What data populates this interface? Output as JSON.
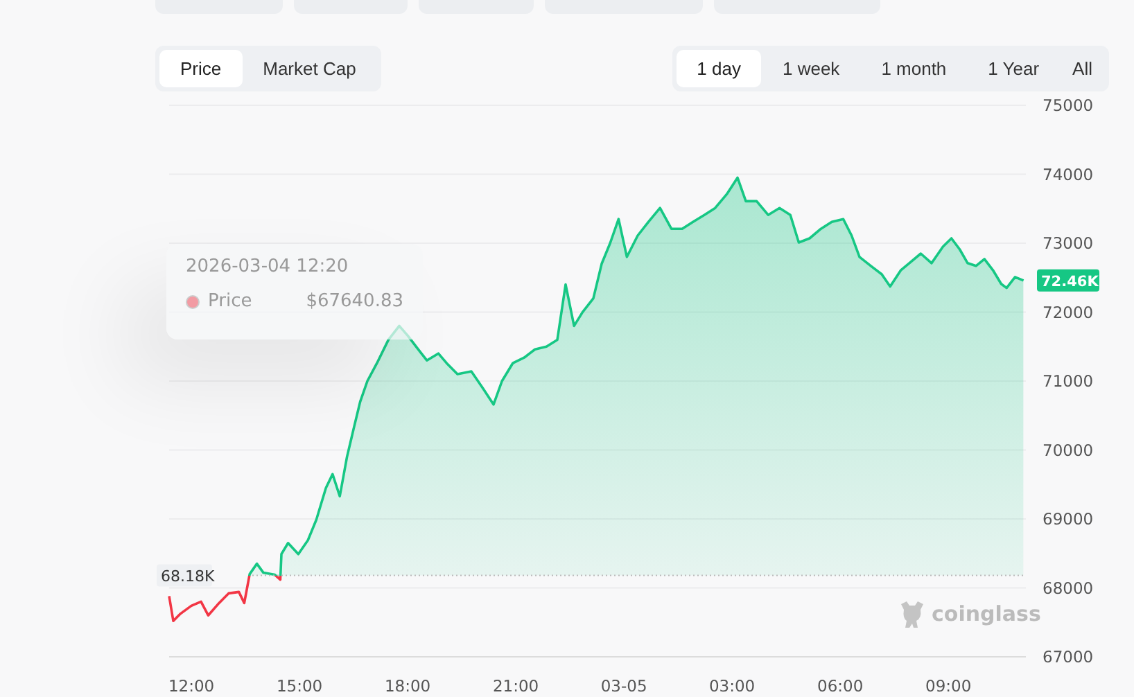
{
  "metric_tabs": [
    {
      "label": "Price",
      "selected": true
    },
    {
      "label": "Market Cap",
      "selected": false
    }
  ],
  "range_tabs": [
    {
      "label": "1 day",
      "selected": true
    },
    {
      "label": "1 week",
      "selected": false
    },
    {
      "label": "1 month",
      "selected": false
    },
    {
      "label": "1 Year",
      "selected": false
    },
    {
      "label": "All",
      "selected": false
    }
  ],
  "chart": {
    "below_baseline": {
      "color": "#f23645"
    },
    "last_price_label": "72.46K",
    "tooltip": {
      "time": "2026-03-04 12:20",
      "value": "$67640.83",
      "color": "#f29ba3"
    },
    "brand": {
      "name": "coinglass"
    },
    "chart_data": {
      "type": "area",
      "x": [
        "2026-03-04T11:23",
        "2026-03-04T11:30",
        "2026-03-04T11:41",
        "2026-03-04T12:00",
        "2026-03-04T12:16",
        "2026-03-04T12:28",
        "2026-03-04T12:46",
        "2026-03-04T13:02",
        "2026-03-04T13:19",
        "2026-03-04T13:28",
        "2026-03-04T13:37",
        "2026-03-04T13:49",
        "2026-03-04T14:00",
        "2026-03-04T14:19",
        "2026-03-04T14:28",
        "2026-03-04T14:30",
        "2026-03-04T14:41",
        "2026-03-04T14:58",
        "2026-03-04T15:14",
        "2026-03-04T15:28",
        "2026-03-04T15:44",
        "2026-03-04T15:55",
        "2026-03-04T16:07",
        "2026-03-04T16:19",
        "2026-03-04T16:30",
        "2026-03-04T16:41",
        "2026-03-04T16:53",
        "2026-03-04T17:09",
        "2026-03-04T17:28",
        "2026-03-04T17:46",
        "2026-03-04T18:00",
        "2026-03-04T18:14",
        "2026-03-04T18:32",
        "2026-03-04T18:51",
        "2026-03-04T19:05",
        "2026-03-04T19:23",
        "2026-03-04T19:46",
        "2026-03-04T20:05",
        "2026-03-04T20:23",
        "2026-03-04T20:37",
        "2026-03-04T20:55",
        "2026-03-04T21:14",
        "2026-03-04T21:32",
        "2026-03-04T21:51",
        "2026-03-04T22:09",
        "2026-03-04T22:23",
        "2026-03-04T22:37",
        "2026-03-04T22:51",
        "2026-03-04T23:09",
        "2026-03-04T23:23",
        "2026-03-04T23:37",
        "2026-03-04T23:51",
        "2026-03-05T00:05",
        "2026-03-05T00:23",
        "2026-03-05T00:41",
        "2026-03-05T01:00",
        "2026-03-05T01:19",
        "2026-03-05T01:37",
        "2026-03-05T01:55",
        "2026-03-05T02:14",
        "2026-03-05T02:32",
        "2026-03-05T02:51",
        "2026-03-05T03:09",
        "2026-03-05T03:23",
        "2026-03-05T03:41",
        "2026-03-05T04:00",
        "2026-03-05T04:19",
        "2026-03-05T04:37",
        "2026-03-05T04:51",
        "2026-03-05T05:09",
        "2026-03-05T05:28",
        "2026-03-05T05:46",
        "2026-03-05T06:05",
        "2026-03-05T06:19",
        "2026-03-05T06:32",
        "2026-03-05T06:51",
        "2026-03-05T07:09",
        "2026-03-05T07:23",
        "2026-03-05T07:41",
        "2026-03-05T07:55",
        "2026-03-05T08:14",
        "2026-03-05T08:32",
        "2026-03-05T08:51",
        "2026-03-05T09:05",
        "2026-03-05T09:19",
        "2026-03-05T09:32",
        "2026-03-05T09:46",
        "2026-03-05T10:00",
        "2026-03-05T10:14",
        "2026-03-05T10:28",
        "2026-03-05T10:37",
        "2026-03-05T10:51",
        "2026-03-05T11:05"
      ],
      "series": [
        {
          "name": "Price",
          "color": "#16c784",
          "values": [
            67880,
            67520,
            67620,
            67740,
            67800,
            67600,
            67780,
            67920,
            67940,
            67780,
            68200,
            68350,
            68220,
            68190,
            68120,
            68490,
            68650,
            68490,
            68690,
            68990,
            69450,
            69650,
            69330,
            69900,
            70300,
            70700,
            71000,
            71260,
            71600,
            71800,
            71660,
            71500,
            71300,
            71400,
            71260,
            71100,
            71140,
            70900,
            70660,
            71000,
            71260,
            71340,
            71460,
            71500,
            71600,
            72400,
            71800,
            72000,
            72200,
            72700,
            73000,
            73350,
            72800,
            73110,
            73310,
            73510,
            73210,
            73210,
            73310,
            73410,
            73510,
            73710,
            73950,
            73610,
            73610,
            73410,
            73510,
            73410,
            73010,
            73070,
            73210,
            73310,
            73350,
            73110,
            72800,
            72670,
            72550,
            72370,
            72610,
            72710,
            72850,
            72710,
            72950,
            73070,
            72910,
            72710,
            72670,
            72770,
            72610,
            72410,
            72350,
            72510,
            72460
          ]
        }
      ],
      "xlim": [
        "2026-03-04T11:23",
        "2026-03-05T11:09"
      ],
      "ylim": [
        67000,
        75000
      ],
      "xticks": [
        {
          "value": "2026-03-04T12:00",
          "label": "12:00"
        },
        {
          "value": "2026-03-04T15:00",
          "label": "15:00"
        },
        {
          "value": "2026-03-04T18:00",
          "label": "18:00"
        },
        {
          "value": "2026-03-04T21:00",
          "label": "21:00"
        },
        {
          "value": "2026-03-05T00:00",
          "label": "03-05"
        },
        {
          "value": "2026-03-05T03:00",
          "label": "03:00"
        },
        {
          "value": "2026-03-05T06:00",
          "label": "06:00"
        },
        {
          "value": "2026-03-05T09:00",
          "label": "09:00"
        }
      ],
      "yticks": [
        67000,
        68000,
        69000,
        70000,
        71000,
        72000,
        73000,
        74000,
        75000
      ],
      "grid": true,
      "ref_lines": [
        {
          "axis": "y",
          "value": 68180,
          "label": "68.18K"
        }
      ]
    }
  }
}
